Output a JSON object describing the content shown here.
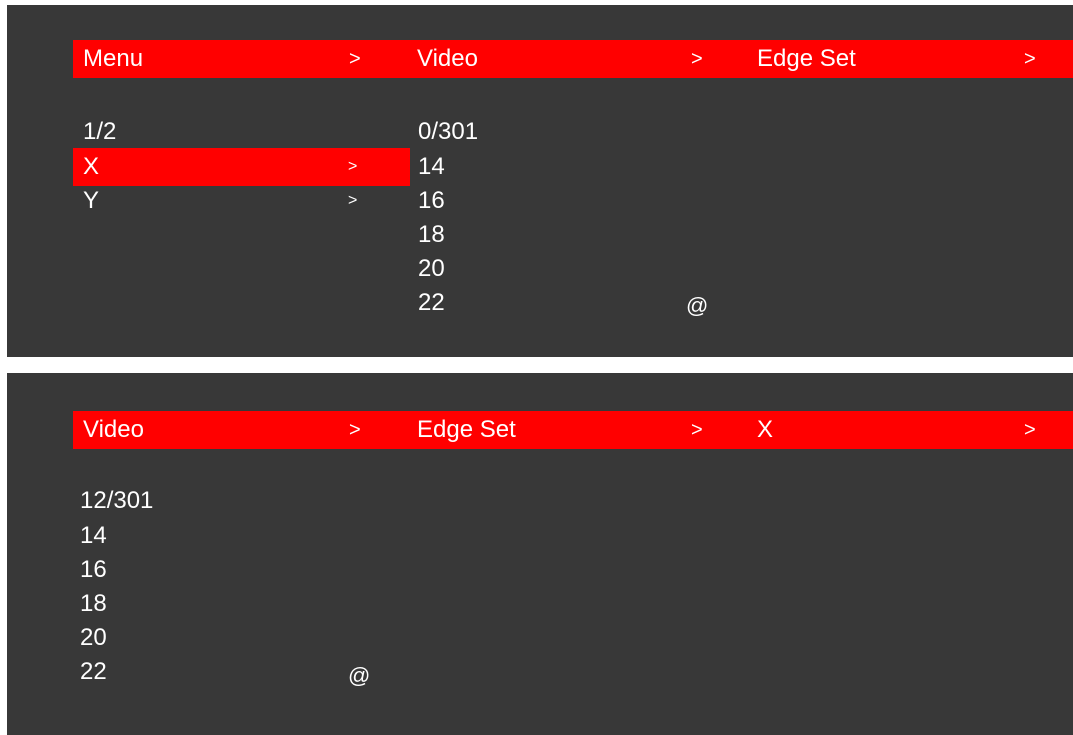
{
  "panel1": {
    "breadcrumb": [
      {
        "label": "Menu",
        "arrow": ">"
      },
      {
        "label": "Video",
        "arrow": ">"
      },
      {
        "label": "Edge Set",
        "arrow": ">"
      }
    ],
    "left_list": {
      "page": "1/2",
      "items": [
        {
          "label": "X",
          "arrow": ">",
          "selected": true
        },
        {
          "label": "Y",
          "arrow": ">",
          "selected": false
        }
      ]
    },
    "right_list": {
      "page": "0/301",
      "values": [
        "14",
        "16",
        "18",
        "20",
        "22"
      ],
      "cursor": "@"
    }
  },
  "panel2": {
    "breadcrumb": [
      {
        "label": "Video",
        "arrow": ">"
      },
      {
        "label": "Edge Set",
        "arrow": ">"
      },
      {
        "label": "X",
        "arrow": ">"
      }
    ],
    "list": {
      "page": "12/301",
      "values": [
        "14",
        "16",
        "18",
        "20",
        "22"
      ],
      "cursor": "@"
    }
  },
  "colors": {
    "background": "#383838",
    "highlight": "#ff0000",
    "text": "#ffffff"
  }
}
